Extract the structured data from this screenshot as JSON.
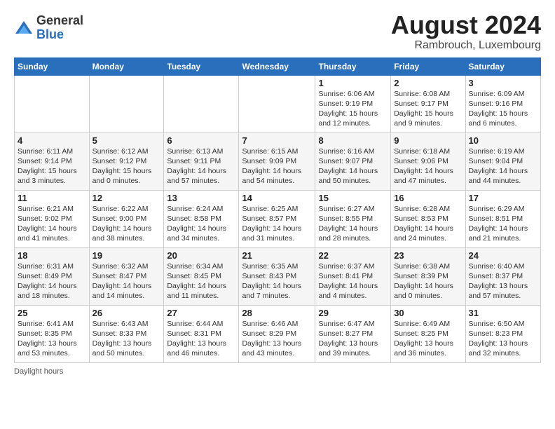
{
  "logo": {
    "general": "General",
    "blue": "Blue"
  },
  "title": "August 2024",
  "location": "Rambrouch, Luxembourg",
  "weekdays": [
    "Sunday",
    "Monday",
    "Tuesday",
    "Wednesday",
    "Thursday",
    "Friday",
    "Saturday"
  ],
  "footer": "Daylight hours",
  "weeks": [
    [
      {
        "day": "",
        "sunrise": "",
        "sunset": "",
        "daylight": ""
      },
      {
        "day": "",
        "sunrise": "",
        "sunset": "",
        "daylight": ""
      },
      {
        "day": "",
        "sunrise": "",
        "sunset": "",
        "daylight": ""
      },
      {
        "day": "",
        "sunrise": "",
        "sunset": "",
        "daylight": ""
      },
      {
        "day": "1",
        "sunrise": "Sunrise: 6:06 AM",
        "sunset": "Sunset: 9:19 PM",
        "daylight": "Daylight: 15 hours and 12 minutes."
      },
      {
        "day": "2",
        "sunrise": "Sunrise: 6:08 AM",
        "sunset": "Sunset: 9:17 PM",
        "daylight": "Daylight: 15 hours and 9 minutes."
      },
      {
        "day": "3",
        "sunrise": "Sunrise: 6:09 AM",
        "sunset": "Sunset: 9:16 PM",
        "daylight": "Daylight: 15 hours and 6 minutes."
      }
    ],
    [
      {
        "day": "4",
        "sunrise": "Sunrise: 6:11 AM",
        "sunset": "Sunset: 9:14 PM",
        "daylight": "Daylight: 15 hours and 3 minutes."
      },
      {
        "day": "5",
        "sunrise": "Sunrise: 6:12 AM",
        "sunset": "Sunset: 9:12 PM",
        "daylight": "Daylight: 15 hours and 0 minutes."
      },
      {
        "day": "6",
        "sunrise": "Sunrise: 6:13 AM",
        "sunset": "Sunset: 9:11 PM",
        "daylight": "Daylight: 14 hours and 57 minutes."
      },
      {
        "day": "7",
        "sunrise": "Sunrise: 6:15 AM",
        "sunset": "Sunset: 9:09 PM",
        "daylight": "Daylight: 14 hours and 54 minutes."
      },
      {
        "day": "8",
        "sunrise": "Sunrise: 6:16 AM",
        "sunset": "Sunset: 9:07 PM",
        "daylight": "Daylight: 14 hours and 50 minutes."
      },
      {
        "day": "9",
        "sunrise": "Sunrise: 6:18 AM",
        "sunset": "Sunset: 9:06 PM",
        "daylight": "Daylight: 14 hours and 47 minutes."
      },
      {
        "day": "10",
        "sunrise": "Sunrise: 6:19 AM",
        "sunset": "Sunset: 9:04 PM",
        "daylight": "Daylight: 14 hours and 44 minutes."
      }
    ],
    [
      {
        "day": "11",
        "sunrise": "Sunrise: 6:21 AM",
        "sunset": "Sunset: 9:02 PM",
        "daylight": "Daylight: 14 hours and 41 minutes."
      },
      {
        "day": "12",
        "sunrise": "Sunrise: 6:22 AM",
        "sunset": "Sunset: 9:00 PM",
        "daylight": "Daylight: 14 hours and 38 minutes."
      },
      {
        "day": "13",
        "sunrise": "Sunrise: 6:24 AM",
        "sunset": "Sunset: 8:58 PM",
        "daylight": "Daylight: 14 hours and 34 minutes."
      },
      {
        "day": "14",
        "sunrise": "Sunrise: 6:25 AM",
        "sunset": "Sunset: 8:57 PM",
        "daylight": "Daylight: 14 hours and 31 minutes."
      },
      {
        "day": "15",
        "sunrise": "Sunrise: 6:27 AM",
        "sunset": "Sunset: 8:55 PM",
        "daylight": "Daylight: 14 hours and 28 minutes."
      },
      {
        "day": "16",
        "sunrise": "Sunrise: 6:28 AM",
        "sunset": "Sunset: 8:53 PM",
        "daylight": "Daylight: 14 hours and 24 minutes."
      },
      {
        "day": "17",
        "sunrise": "Sunrise: 6:29 AM",
        "sunset": "Sunset: 8:51 PM",
        "daylight": "Daylight: 14 hours and 21 minutes."
      }
    ],
    [
      {
        "day": "18",
        "sunrise": "Sunrise: 6:31 AM",
        "sunset": "Sunset: 8:49 PM",
        "daylight": "Daylight: 14 hours and 18 minutes."
      },
      {
        "day": "19",
        "sunrise": "Sunrise: 6:32 AM",
        "sunset": "Sunset: 8:47 PM",
        "daylight": "Daylight: 14 hours and 14 minutes."
      },
      {
        "day": "20",
        "sunrise": "Sunrise: 6:34 AM",
        "sunset": "Sunset: 8:45 PM",
        "daylight": "Daylight: 14 hours and 11 minutes."
      },
      {
        "day": "21",
        "sunrise": "Sunrise: 6:35 AM",
        "sunset": "Sunset: 8:43 PM",
        "daylight": "Daylight: 14 hours and 7 minutes."
      },
      {
        "day": "22",
        "sunrise": "Sunrise: 6:37 AM",
        "sunset": "Sunset: 8:41 PM",
        "daylight": "Daylight: 14 hours and 4 minutes."
      },
      {
        "day": "23",
        "sunrise": "Sunrise: 6:38 AM",
        "sunset": "Sunset: 8:39 PM",
        "daylight": "Daylight: 14 hours and 0 minutes."
      },
      {
        "day": "24",
        "sunrise": "Sunrise: 6:40 AM",
        "sunset": "Sunset: 8:37 PM",
        "daylight": "Daylight: 13 hours and 57 minutes."
      }
    ],
    [
      {
        "day": "25",
        "sunrise": "Sunrise: 6:41 AM",
        "sunset": "Sunset: 8:35 PM",
        "daylight": "Daylight: 13 hours and 53 minutes."
      },
      {
        "day": "26",
        "sunrise": "Sunrise: 6:43 AM",
        "sunset": "Sunset: 8:33 PM",
        "daylight": "Daylight: 13 hours and 50 minutes."
      },
      {
        "day": "27",
        "sunrise": "Sunrise: 6:44 AM",
        "sunset": "Sunset: 8:31 PM",
        "daylight": "Daylight: 13 hours and 46 minutes."
      },
      {
        "day": "28",
        "sunrise": "Sunrise: 6:46 AM",
        "sunset": "Sunset: 8:29 PM",
        "daylight": "Daylight: 13 hours and 43 minutes."
      },
      {
        "day": "29",
        "sunrise": "Sunrise: 6:47 AM",
        "sunset": "Sunset: 8:27 PM",
        "daylight": "Daylight: 13 hours and 39 minutes."
      },
      {
        "day": "30",
        "sunrise": "Sunrise: 6:49 AM",
        "sunset": "Sunset: 8:25 PM",
        "daylight": "Daylight: 13 hours and 36 minutes."
      },
      {
        "day": "31",
        "sunrise": "Sunrise: 6:50 AM",
        "sunset": "Sunset: 8:23 PM",
        "daylight": "Daylight: 13 hours and 32 minutes."
      }
    ]
  ]
}
